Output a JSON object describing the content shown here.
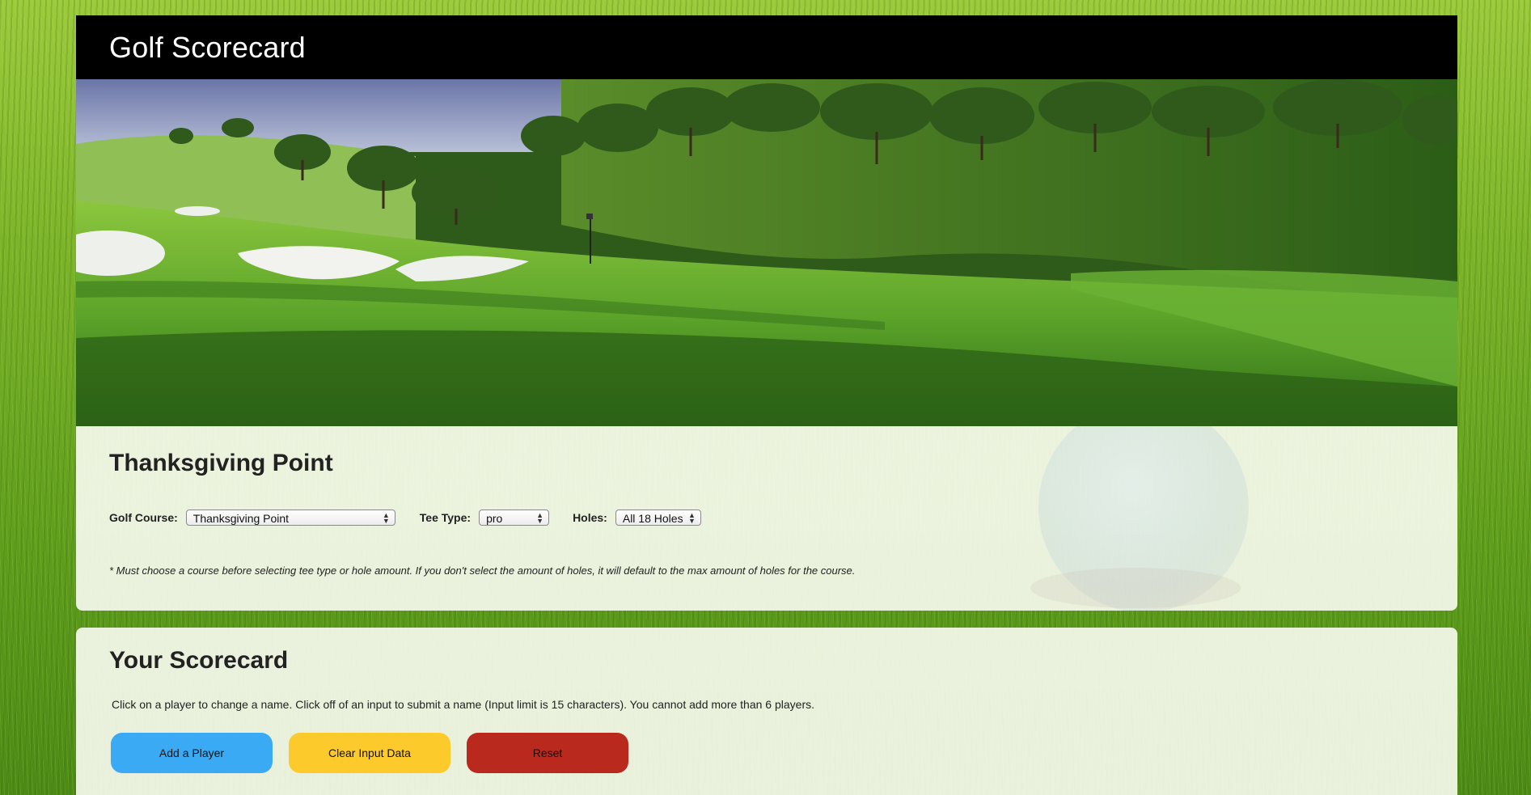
{
  "app": {
    "title": "Golf Scorecard"
  },
  "colors": {
    "header_bg": "#000000",
    "add_player": "#3aaaf5",
    "clear_input": "#fcca2b",
    "reset": "#b9291d"
  },
  "course_panel": {
    "title": "Thanksgiving Point",
    "golf_course_label": "Golf Course:",
    "golf_course_value": "Thanksgiving Point",
    "tee_type_label": "Tee Type:",
    "tee_type_value": "pro",
    "holes_label": "Holes:",
    "holes_value": "All 18 Holes",
    "note": "* Must choose a course before selecting tee type or hole amount. If you don't select the amount of holes, it will default to the max amount of holes for the course."
  },
  "scorecard_panel": {
    "title": "Your Scorecard",
    "instructions": "Click on a player to change a name. Click off of an input to submit a name (Input limit is 15 characters). You cannot add more than 6 players.",
    "buttons": {
      "add_player": "Add a Player",
      "clear_input": "Clear Input Data",
      "reset": "Reset"
    }
  },
  "icons": {
    "select_arrows": "select-updown-arrows-icon"
  }
}
